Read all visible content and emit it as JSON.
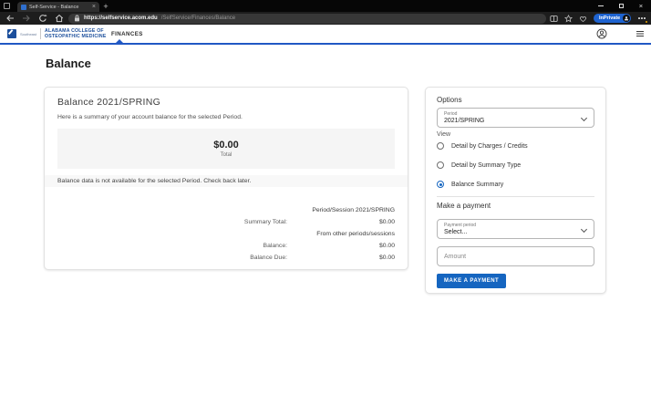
{
  "browser": {
    "tab": {
      "title": "Self-Service - Balance"
    },
    "address": {
      "host": "https://selfservice.acom.edu",
      "path": "/SelfService/Finances/Balance"
    },
    "inprivate_label": "InPrivate",
    "icons": {
      "tab_close": "×",
      "new_tab": "+",
      "window_close": "×"
    }
  },
  "app_header": {
    "brand": {
      "mark_text": "Southeast",
      "line1": "ALABAMA COLLEGE OF",
      "line2": "OSTEOPATHIC MEDICINE"
    },
    "nav_finances": "FINANCES"
  },
  "page_title": "Balance",
  "balance_card": {
    "heading": "Balance 2021/SPRING",
    "description": "Here is a summary of your account balance for the selected Period.",
    "total_amount": "$0.00",
    "total_label": "Total",
    "notice": "Balance data is not available for the selected Period. Check back later.",
    "summary_rows": [
      {
        "label": "",
        "value": "Period/Session 2021/SPRING"
      },
      {
        "label": "Summary Total:",
        "value": "$0.00"
      },
      {
        "label": "",
        "value": "From other periods/sessions"
      },
      {
        "label": "Balance:",
        "value": "$0.00"
      },
      {
        "label": "Balance Due:",
        "value": "$0.00"
      }
    ]
  },
  "options": {
    "heading": "Options",
    "period_label": "Period",
    "period_value": "2021/SPRING",
    "view_label": "View",
    "view_options": [
      {
        "label": "Detail by Charges / Credits",
        "selected": false
      },
      {
        "label": "Detail by Summary Type",
        "selected": false
      },
      {
        "label": "Balance Summary",
        "selected": true
      }
    ],
    "payment_heading": "Make a payment",
    "payment_period_label": "Payment period",
    "payment_period_value": "Select...",
    "amount_placeholder": "Amount",
    "pay_button_label": "MAKE A PAYMENT"
  },
  "colors": {
    "accent_blue": "#2158c4",
    "brand_blue": "#1c4f9c",
    "button_blue": "#1565c0",
    "inprivate_blue": "#1e63d0",
    "notification_dot": "#eaa500"
  }
}
